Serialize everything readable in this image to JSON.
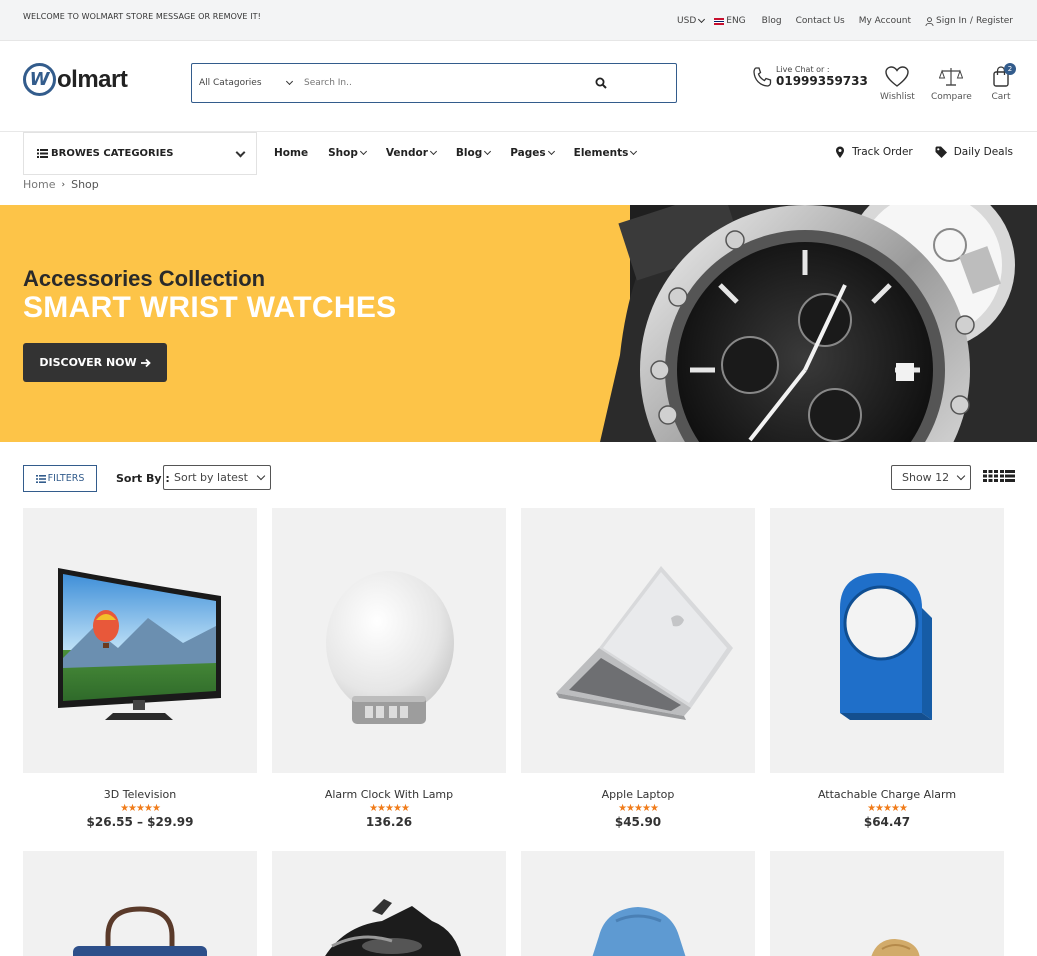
{
  "topbar": {
    "welcome": "WELCOME TO WOLMART STORE MESSAGE OR REMOVE IT!",
    "currency": "USD",
    "language": "ENG",
    "links": [
      "Blog",
      "Contact Us",
      "My Account"
    ],
    "signin": "Sign In",
    "register": "Register"
  },
  "header": {
    "logo_letter": "W",
    "logo_text": "olmart",
    "search_category": "All Catagories",
    "search_placeholder": "Search In..",
    "live_chat": "Live Chat or :",
    "phone": "01999359733",
    "wishlist": "Wishlist",
    "compare": "Compare",
    "cart": "Cart",
    "cart_count": "2"
  },
  "nav": {
    "browse": "BROWES CATEGORIES",
    "items": [
      "Home",
      "Shop",
      "Vendor",
      "Blog",
      "Pages",
      "Elements"
    ],
    "track_order": "Track Order",
    "daily_deals": "Daily Deals"
  },
  "breadcrumb": {
    "home": "Home",
    "current": "Shop"
  },
  "banner": {
    "subtitle": "Accessories Collection",
    "title": "SMART WRIST WATCHES",
    "button": "DISCOVER NOW",
    "color": "#fdc448"
  },
  "toolbar": {
    "filters": "FILTERS",
    "sort_label": "Sort By :",
    "sort_value": "Sort by latest",
    "show_value": "Show 12"
  },
  "products": [
    {
      "name": "3D Television",
      "price": "$26.55 – $29.99",
      "stars": "★★★★★"
    },
    {
      "name": "Alarm Clock With Lamp",
      "price": "136.26",
      "stars": "★★★★★"
    },
    {
      "name": "Apple Laptop",
      "price": "$45.90",
      "stars": "★★★★★"
    },
    {
      "name": "Attachable Charge Alarm",
      "price": "$64.47",
      "stars": "★★★★★"
    }
  ],
  "colors": {
    "accent": "#335c8c",
    "star": "#f07c1b"
  }
}
